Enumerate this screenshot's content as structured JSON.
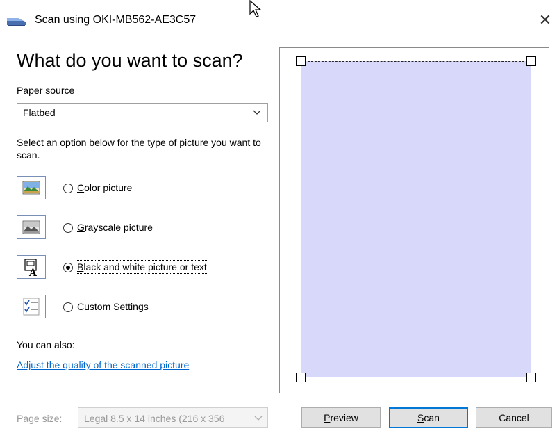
{
  "window": {
    "title": "Scan using OKI-MB562-AE3C57",
    "close_glyph": "✕",
    "icons": {
      "title": "scanner-icon",
      "close": "close-icon",
      "cursor": "mouse-cursor-icon"
    }
  },
  "main": {
    "heading": "What do you want to scan?",
    "paper_source": {
      "label_accel": "P",
      "label_rest": "aper source",
      "value": "Flatbed"
    },
    "instructions": "Select an option below for the type of picture you want to scan.",
    "options": [
      {
        "accel": "C",
        "rest": "olor picture",
        "checked": false,
        "icon": "color-picture-icon"
      },
      {
        "accel": "G",
        "rest": "rayscale picture",
        "checked": false,
        "icon": "grayscale-picture-icon"
      },
      {
        "accel": "B",
        "rest": "lack and white picture or text",
        "checked": true,
        "icon": "black-white-text-icon"
      },
      {
        "accel": "C",
        "rest": "ustom Settings",
        "checked": false,
        "icon": "custom-settings-icon"
      }
    ],
    "also_label": "You can also:",
    "adjust_link": "Adjust the quality of the scanned picture",
    "page_size": {
      "label_pre": "Page si",
      "label_accel": "z",
      "label_post": "e:",
      "value": "Legal 8.5 x 14 inches (216 x 356"
    }
  },
  "buttons": {
    "preview": {
      "accel": "P",
      "rest": "review"
    },
    "scan": {
      "accel": "S",
      "rest": "can"
    },
    "cancel": "Cancel"
  },
  "colors": {
    "scan_area": "#d8d8fa",
    "link": "#0066cc",
    "default_button_border": "#0078d7"
  }
}
